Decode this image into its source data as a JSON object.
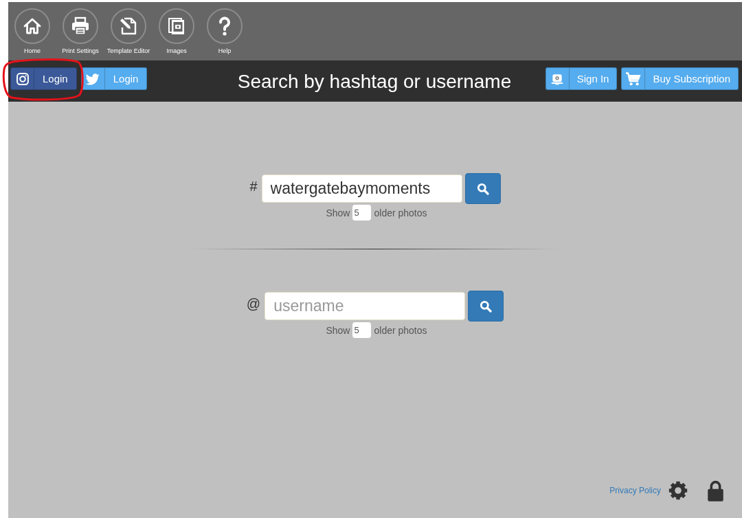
{
  "toolbar": {
    "items": [
      {
        "kind": "home",
        "label": "Home"
      },
      {
        "kind": "print",
        "label": "Print Settings"
      },
      {
        "kind": "template",
        "label": "Template Editor"
      },
      {
        "kind": "images",
        "label": "Images"
      },
      {
        "kind": "help",
        "label": "Help"
      }
    ]
  },
  "header": {
    "login_buttons": [
      {
        "kind": "instagram",
        "label": "Login",
        "circled": true
      },
      {
        "kind": "twitter",
        "label": "Login",
        "circled": false
      }
    ],
    "title": "Search by hashtag or username",
    "account_buttons": [
      {
        "kind": "sign-in",
        "label": "Sign In"
      },
      {
        "kind": "cart",
        "label": "Buy Subscription"
      }
    ]
  },
  "searches": [
    {
      "prefix": "#",
      "value": "watergatebaymoments",
      "show_label": "Show",
      "count": "5",
      "suffix_label": "older photos"
    },
    {
      "prefix": "@",
      "placeholder": "username",
      "show_label": "Show",
      "count": "5",
      "suffix_label": "older photos"
    }
  ],
  "footer": {
    "link": "Privacy Policy"
  }
}
